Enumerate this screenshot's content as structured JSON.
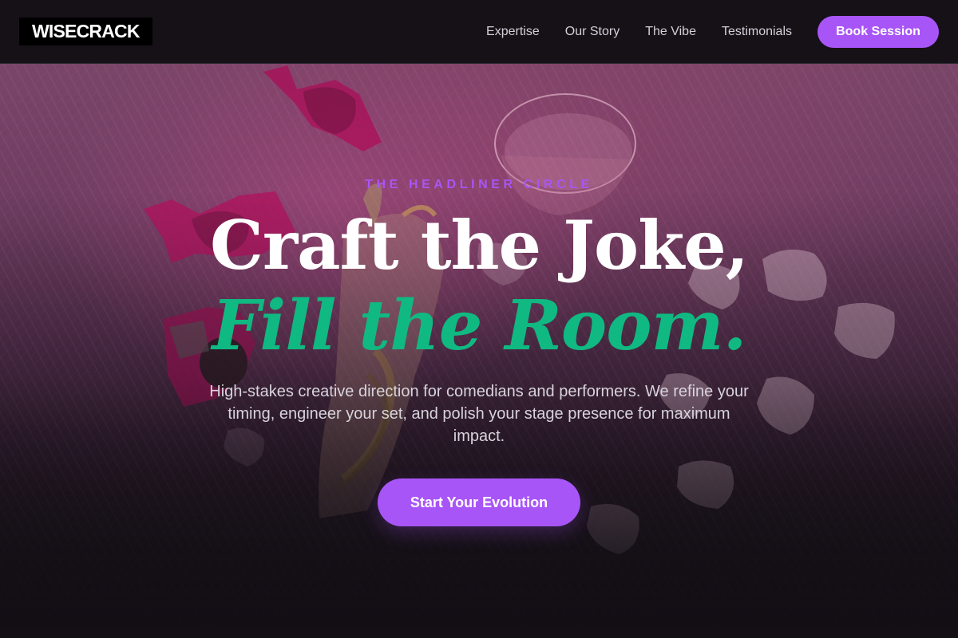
{
  "brand": {
    "logo_text": "WISECRACK"
  },
  "nav": {
    "links": [
      {
        "label": "Expertise"
      },
      {
        "label": "Our Story"
      },
      {
        "label": "The Vibe"
      },
      {
        "label": "Testimonials"
      }
    ],
    "cta_label": "Book Session"
  },
  "hero": {
    "eyebrow": "THE HEADLINER CIRCLE",
    "headline_line1": "Craft the Joke,",
    "headline_line2": "Fill the Room.",
    "description": "High-stakes creative direction for comedians and performers. We refine your timing, engineer your set, and polish your stage presence for maximum impact.",
    "cta_label": "Start Your Evolution"
  },
  "colors": {
    "accent_purple": "#a855f7",
    "accent_green": "#10b981",
    "nav_background": "#161117",
    "page_background": "#131015"
  },
  "background_image": {
    "icon": "hero-photo-fur-candy-hand"
  }
}
